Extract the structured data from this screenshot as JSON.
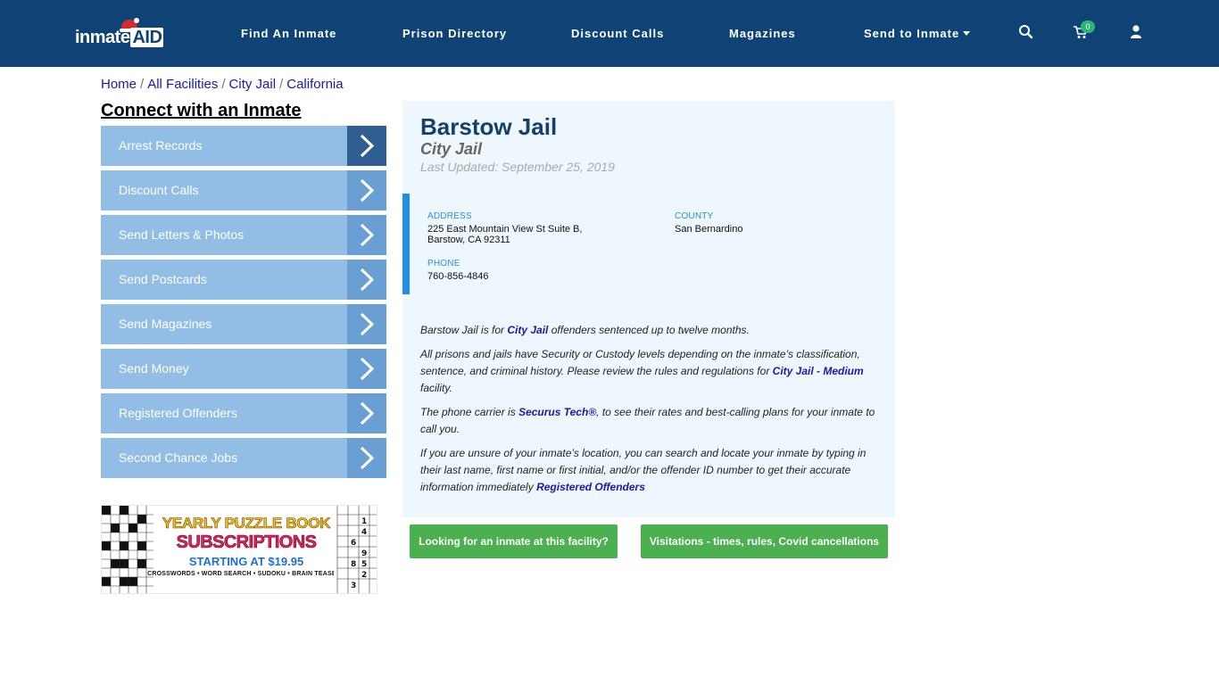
{
  "header": {
    "logo": {
      "part1": "inmate",
      "part2": "AID"
    },
    "nav": [
      {
        "label": "Find An Inmate"
      },
      {
        "label": "Prison Directory"
      },
      {
        "label": "Discount Calls"
      },
      {
        "label": "Magazines"
      },
      {
        "label": "Send to Inmate"
      }
    ],
    "cart_count": "0",
    "icons": [
      "search-icon",
      "cart-icon",
      "user-icon"
    ]
  },
  "breadcrumb": [
    "Home",
    "All Facilities",
    "City Jail",
    "California"
  ],
  "sidebar": {
    "title": "Connect with an Inmate",
    "items": [
      {
        "label": "Arrest Records"
      },
      {
        "label": "Discount Calls"
      },
      {
        "label": "Send Letters & Photos"
      },
      {
        "label": "Send Postcards"
      },
      {
        "label": "Send Magazines"
      },
      {
        "label": "Send Money"
      },
      {
        "label": "Registered Offenders"
      },
      {
        "label": "Second Chance Jobs"
      }
    ]
  },
  "banner": {
    "line1": "YEARLY PUZZLE BOOK",
    "line2": "SUBSCRIPTIONS",
    "line3": "STARTING AT $19.95",
    "line4": "CROSSWORDS • WORD SEARCH • SUDOKU • BRAIN TEASERS"
  },
  "facility": {
    "name": "Barstow Jail",
    "type": "City Jail",
    "updated": "Last Updated: September 25, 2019",
    "address_label": "ADDRESS",
    "address_line1": "225 East Mountain View St Suite B,",
    "address_line2": "Barstow, CA 92311",
    "county_label": "COUNTY",
    "county": "San Bernardino",
    "phone_label": "PHONE",
    "phone": "760-856-4846"
  },
  "description": {
    "p1_a": "Barstow Jail is for ",
    "p1_link": "City Jail",
    "p1_b": " offenders sentenced up to twelve months.",
    "p2_a": "All prisons and jails have Security or Custody levels depending on the inmate’s classification, sentence, and criminal history. Please review the rules and regulations for ",
    "p2_link": "City Jail - Medium",
    "p2_b": " facility.",
    "p3_a": "The phone carrier is ",
    "p3_link": "Securus Tech®",
    "p3_b": ", to see their rates and best-calling plans for your inmate to call you.",
    "p4_a": "If you are unsure of your inmate’s location, you can search and locate your inmate by typing in their last name, first name or first initial, and/or the offender ID number to get their accurate information immediately ",
    "p4_link": "Registered Offenders"
  },
  "buttons": {
    "find_inmate": "Looking for an inmate at this facility?",
    "visitation": "Visitations - times, rules, Covid cancellations"
  },
  "colors": {
    "header_bg": "#0f4375",
    "sidebar_item": "#92bde4",
    "sidebar_arrow": "#6a9fd4",
    "card_bg": "#eef7fd",
    "accent_bar": "#1e8ee6",
    "button_green": "#4caf50"
  }
}
